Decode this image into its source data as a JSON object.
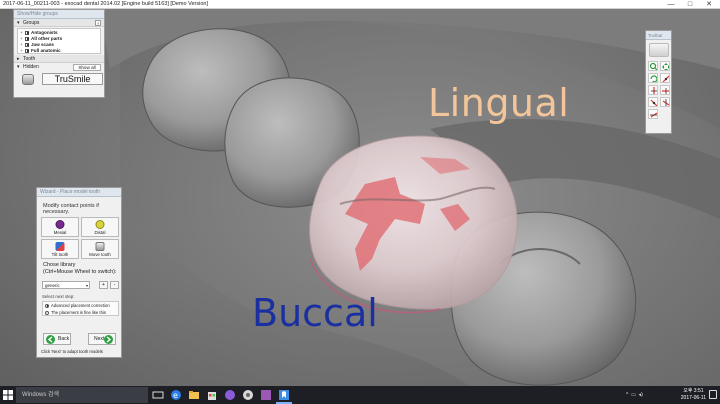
{
  "window": {
    "title": "2017-06-11_00211-003 - exocad dental 2014.02 [Engine build 5163] [Demo Version]",
    "controls": {
      "minimize": "—",
      "maximize": "□",
      "close": "✕"
    }
  },
  "viewport": {
    "labels": {
      "lingual": "Lingual",
      "buccal": "Buccal"
    }
  },
  "groups_panel": {
    "title": "Show/Hide groups",
    "groups_section": "Groups",
    "help": "?",
    "tree": [
      {
        "label": "Antagonists",
        "checked": true
      },
      {
        "label": "All other parts",
        "checked": true
      },
      {
        "label": "Jaw scans",
        "checked": true
      },
      {
        "label": "Full anatomic",
        "checked": true
      }
    ],
    "tooth_section": "Tooth",
    "hidden_section": "Hidden",
    "show_all_button": "Show all",
    "trusmile_button": "TruSmile"
  },
  "toolbar": {
    "title": "Toolbar",
    "icons": [
      "paper-icon",
      "zoom-icon",
      "move-icon",
      "rotate-icon",
      "axis-x-icon",
      "axis-y-icon",
      "axis-z-icon",
      "axis-xy-icon",
      "axis-yz-icon"
    ]
  },
  "wizard": {
    "title": "Wizard - Place model tooth",
    "heading": "Modify contact points if necessary.",
    "buttons": [
      {
        "label": "Mesial",
        "color": "#7a2a8f"
      },
      {
        "label": "Distal",
        "color": "#d8d43a"
      },
      {
        "label": "Tilt tooth",
        "color": "#2a6fd1"
      },
      {
        "label": "Move tooth",
        "color": "#9a9a9a"
      }
    ],
    "library_line1": "Chose library",
    "library_line2": "(Ctrl+Mouse Wheel to switch):",
    "library_value": "generic",
    "plus": "+",
    "minus": "-",
    "next_step_label": "Select next step:",
    "options": [
      {
        "label": "Advanced placement correction",
        "selected": true
      },
      {
        "label": "The placement is fine like this",
        "selected": false
      }
    ],
    "back_button": "Back",
    "next_button": "Next",
    "hint": "Click 'Next' to adapt tooth models"
  },
  "taskbar": {
    "search_placeholder": "Windows 검색",
    "clock_time": "오후 3:51",
    "clock_date": "2017-06-11"
  }
}
